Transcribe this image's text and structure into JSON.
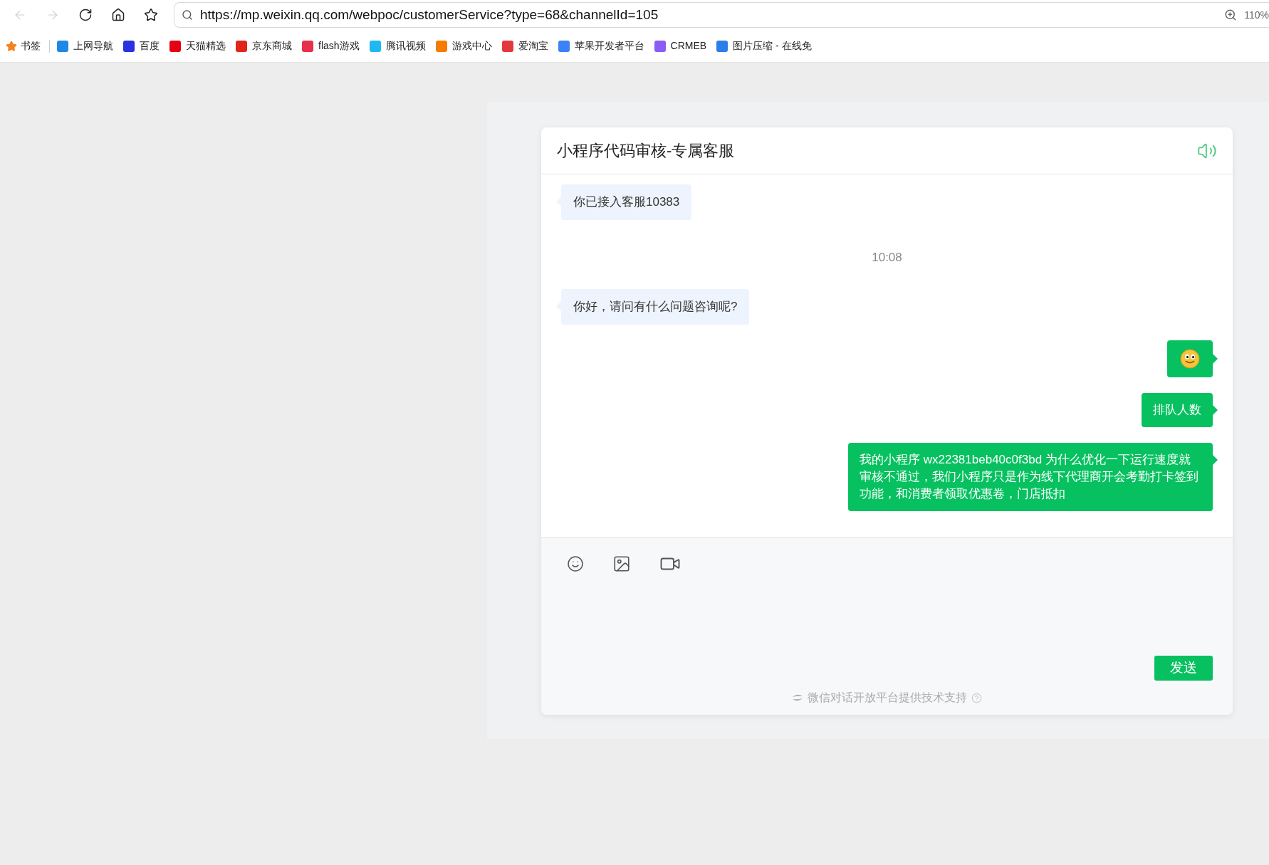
{
  "browser": {
    "nav": [
      {
        "kind": "back",
        "disabled": true
      },
      {
        "kind": "forward",
        "disabled": true
      },
      {
        "kind": "reload",
        "disabled": false
      },
      {
        "kind": "home",
        "disabled": false
      },
      {
        "kind": "favorite",
        "disabled": false
      }
    ],
    "url": "https://mp.weixin.qq.com/webpoc/customerService?type=68&channelId=105",
    "zoom": "110%",
    "bookmarks_label": "书签",
    "bookmarks": [
      {
        "label": "上网导航",
        "color": "#1e88e5"
      },
      {
        "label": "百度",
        "color": "#2932e1"
      },
      {
        "label": "天猫精选",
        "color": "#e60012"
      },
      {
        "label": "京东商城",
        "color": "#e1251b"
      },
      {
        "label": "flash游戏",
        "color": "#e8304a"
      },
      {
        "label": "腾讯视频",
        "color": "#20b8f2"
      },
      {
        "label": "游戏中心",
        "color": "#f57c00"
      },
      {
        "label": "爱淘宝",
        "color": "#e4393c"
      },
      {
        "label": "苹果开发者平台",
        "color": "#3b82f6"
      },
      {
        "label": "CRMEB",
        "color": "#8b5cf6"
      },
      {
        "label": "图片压缩 - 在线免",
        "color": "#2b7de9"
      }
    ]
  },
  "chat": {
    "title": "小程序代码审核-专属客服",
    "messages": [
      {
        "kind": "received",
        "text": "你已接入客服10383"
      },
      {
        "kind": "time",
        "text": "10:08"
      },
      {
        "kind": "received",
        "text": "你好，请问有什么问题咨询呢?"
      },
      {
        "kind": "sent_emoji"
      },
      {
        "kind": "sent",
        "text": "排队人数"
      },
      {
        "kind": "sent",
        "text": "我的小程序 wx22381beb40c0f3bd 为什么优化一下运行速度就审核不通过，我们小程序只是作为线下代理商开会考勤打卡签到功能，和消费者领取优惠卷，门店抵扣"
      }
    ],
    "send_button": "发送",
    "footer": "微信对话开放平台提供技术支持"
  }
}
